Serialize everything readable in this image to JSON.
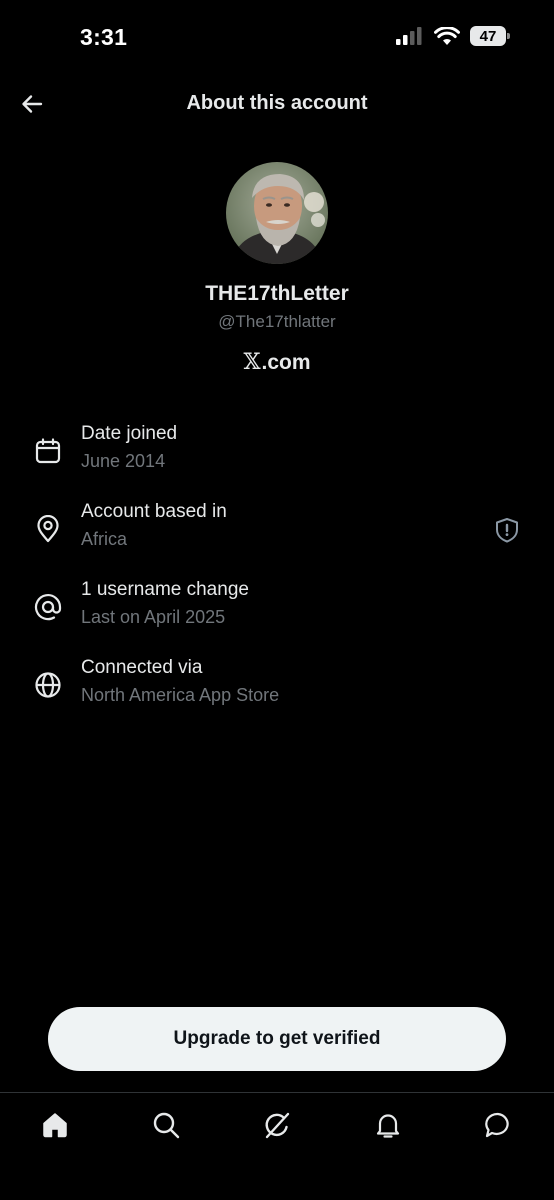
{
  "status_bar": {
    "time": "3:31",
    "battery": "47"
  },
  "header": {
    "title": "About this account"
  },
  "profile": {
    "display_name": "THE17thLetter",
    "handle": "@The17thlatter",
    "site_mark": "𝕏",
    "site_suffix": ".com"
  },
  "details": [
    {
      "icon": "calendar-icon",
      "title": "Date joined",
      "value": "June 2014"
    },
    {
      "icon": "location-pin-icon",
      "title": "Account based in",
      "value": "Africa",
      "trailing_icon": "shield-alert-icon"
    },
    {
      "icon": "at-sign-icon",
      "title": "1 username change",
      "value": "Last on April 2025"
    },
    {
      "icon": "globe-icon",
      "title": "Connected via",
      "value": "North America App Store"
    }
  ],
  "cta": {
    "label": "Upgrade to get verified"
  },
  "bottom_nav": [
    "home-icon",
    "search-icon",
    "grok-icon",
    "notifications-icon",
    "messages-icon"
  ],
  "colors": {
    "background": "#000000",
    "primary_text": "#e7e9ea",
    "secondary_text": "#71767b",
    "button_bg": "#eff3f4"
  }
}
